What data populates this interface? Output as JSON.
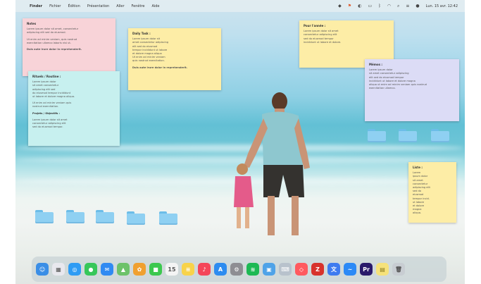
{
  "menubar": {
    "app_name": "Finder",
    "menus": [
      "Fichier",
      "Édition",
      "Présentation",
      "Aller",
      "Fenêtre",
      "Aide"
    ],
    "clock": "Lun. 15 avr. 12:42"
  },
  "notes": [
    {
      "title": "Notes",
      "lines": [
        "Lorem ipsum dolor sit amet, consectetur",
        "adipiscing elit sed do eiusmod.",
        "",
        "Ut enim ad minim veniam, quis nostrud",
        "exercitation ullamco laboris nisi ut.",
        "",
        "Duis aute irure dolor in reprehenderit."
      ]
    },
    {
      "title": "Rituels / Routine :",
      "lines": [
        "Lorem ipsum dolor",
        "sit amet consectetur",
        "adipiscing elit sed",
        "do eiusmod tempor incididunt",
        "ut labore et dolore magna aliqua.",
        "",
        "Ut enim ad minim veniam quis",
        "nostrud exercitation.",
        "",
        "Projets / Objectifs :",
        "",
        "Lorem ipsum dolor sit amet",
        "consectetur adipiscing elit",
        "sed do eiusmod tempor."
      ]
    },
    {
      "title": "Daily Task :",
      "lines": [
        "Lorem ipsum dolor sit",
        "amet consectetur adipiscing",
        "elit sed do eiusmod",
        "tempor incididunt ut labore",
        "et dolore magna aliqua",
        "Ut enim ad minim veniam",
        "quis nostrud exercitation.",
        "",
        "Duis aute irure dolor in reprehenderit."
      ]
    },
    {
      "title": "Pour l'année :",
      "lines": [
        "Lorem ipsum dolor sit amet",
        "consectetur adipiscing elit",
        "sed do eiusmod tempor",
        "incididunt ut labore et dolore."
      ]
    },
    {
      "title": "Mémos :",
      "lines": [
        "Lorem ipsum dolor",
        "sit amet consectetur adipiscing",
        "elit sed do eiusmod tempor",
        "incididunt ut labore et dolore magna",
        "aliqua ut enim ad minim veniam quis nostrud",
        "exercitation ullamco."
      ]
    },
    {
      "title": "Liste :",
      "lines": [
        "Lorem",
        "ipsum dolor",
        "sit amet",
        "consectetur",
        "adipiscing elit",
        "sed do",
        "eiusmod",
        "tempor incid.",
        "ut labore",
        "et dolore",
        "magna",
        "aliqua."
      ]
    }
  ],
  "folders_row": 5,
  "folders_right": 3,
  "dock": {
    "apps": [
      {
        "name": "Finder",
        "color": "#3a8ee6",
        "glyph": "☺"
      },
      {
        "name": "Launchpad",
        "color": "#e8e8ee",
        "glyph": "▦"
      },
      {
        "name": "Safari",
        "color": "#2e9cf4",
        "glyph": "◎"
      },
      {
        "name": "Messages",
        "color": "#37c75a",
        "glyph": "●"
      },
      {
        "name": "Mail",
        "color": "#2f8af2",
        "glyph": "✉"
      },
      {
        "name": "Plans",
        "color": "#6cc26a",
        "glyph": "▲"
      },
      {
        "name": "Photos",
        "color": "#f0a030",
        "glyph": "✿"
      },
      {
        "name": "FaceTime",
        "color": "#3cc84e",
        "glyph": "■"
      },
      {
        "name": "Calendrier",
        "color": "#f4f4f4",
        "glyph": "15"
      },
      {
        "name": "Notes",
        "color": "#f8d34a",
        "glyph": "≡"
      },
      {
        "name": "Musique",
        "color": "#f4465a",
        "glyph": "♪"
      },
      {
        "name": "App Store",
        "color": "#2d8cf0",
        "glyph": "A"
      },
      {
        "name": "Réglages",
        "color": "#8e8e93",
        "glyph": "⚙"
      },
      {
        "name": "Spotify",
        "color": "#1db954",
        "glyph": "≋"
      },
      {
        "name": "Aperçu",
        "color": "#4fa3e8",
        "glyph": "▣"
      },
      {
        "name": "Clavier",
        "color": "#b8c2cc",
        "glyph": "⌨"
      },
      {
        "name": "Airbnb",
        "color": "#ff5a5f",
        "glyph": "◇"
      },
      {
        "name": "Zotero",
        "color": "#d8322c",
        "glyph": "Z"
      },
      {
        "name": "Traduction",
        "color": "#3e7bf0",
        "glyph": "文"
      },
      {
        "name": "Messenger",
        "color": "#2c8af6",
        "glyph": "~"
      },
      {
        "name": "Premiere Pro",
        "color": "#2a1a6a",
        "glyph": "Pr"
      },
      {
        "name": "Pense-bêtes",
        "color": "#f6e27a",
        "glyph": "▤"
      },
      {
        "name": "Corbeille",
        "color": "#c8cdd2",
        "glyph": "🗑"
      }
    ]
  }
}
